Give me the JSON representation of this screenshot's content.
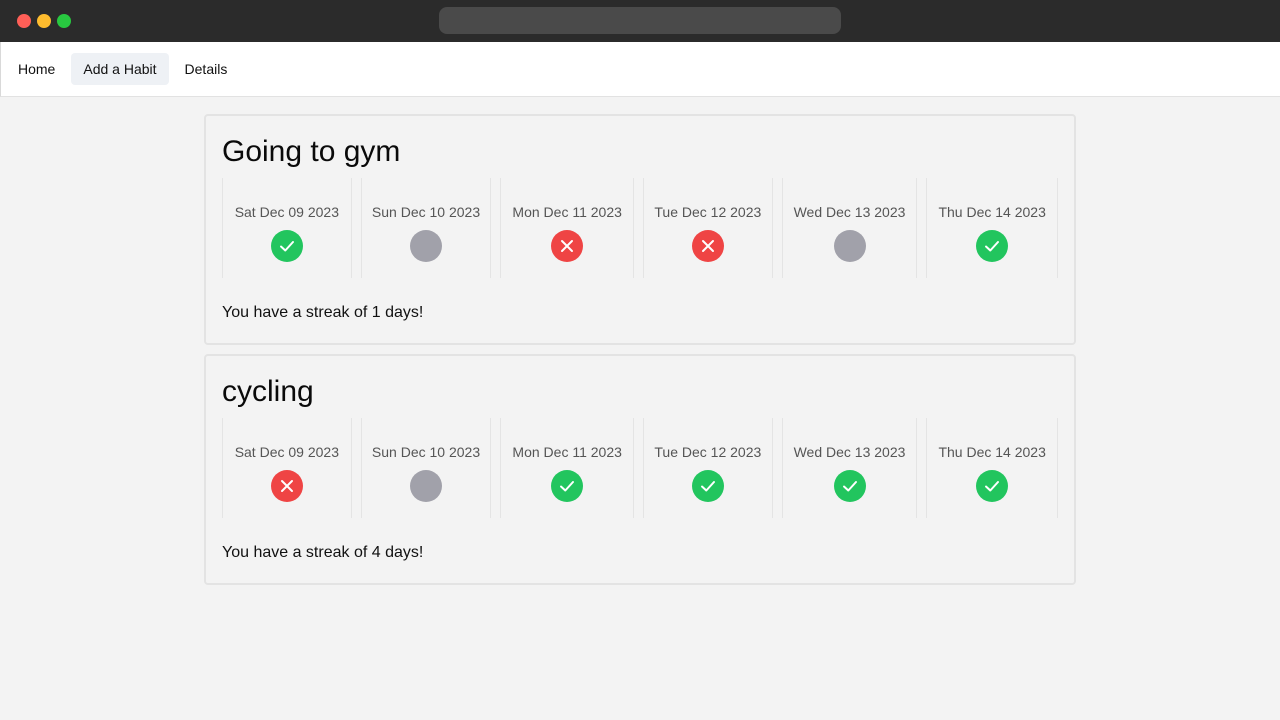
{
  "nav": {
    "items": [
      {
        "label": "Home"
      },
      {
        "label": "Add a Habit"
      },
      {
        "label": "Details"
      }
    ]
  },
  "habits": [
    {
      "title": "Going to gym",
      "days": [
        {
          "date": "Sat Dec 09 2023",
          "status": "done"
        },
        {
          "date": "Sun Dec 10 2023",
          "status": "none"
        },
        {
          "date": "Mon Dec 11 2023",
          "status": "missed"
        },
        {
          "date": "Tue Dec 12 2023",
          "status": "missed"
        },
        {
          "date": "Wed Dec 13 2023",
          "status": "none"
        },
        {
          "date": "Thu Dec 14 2023",
          "status": "done"
        }
      ],
      "streak": "You have a streak of 1 days!"
    },
    {
      "title": "cycling",
      "days": [
        {
          "date": "Sat Dec 09 2023",
          "status": "missed"
        },
        {
          "date": "Sun Dec 10 2023",
          "status": "none"
        },
        {
          "date": "Mon Dec 11 2023",
          "status": "done"
        },
        {
          "date": "Tue Dec 12 2023",
          "status": "done"
        },
        {
          "date": "Wed Dec 13 2023",
          "status": "done"
        },
        {
          "date": "Thu Dec 14 2023",
          "status": "done"
        }
      ],
      "streak": "You have a streak of 4 days!"
    }
  ],
  "colors": {
    "done": "#22c55e",
    "missed": "#ef4444",
    "none": "#a1a1aa"
  },
  "icons": {
    "done": "check-icon",
    "missed": "x-icon",
    "none": "empty-circle-icon"
  }
}
